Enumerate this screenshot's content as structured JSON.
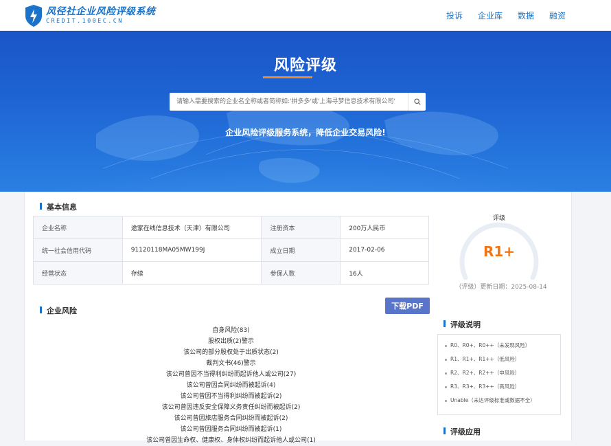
{
  "header": {
    "logo_main": "风径社企业风险评级系统",
    "logo_sub": "CREDIT.100EC.CN",
    "nav": [
      "投诉",
      "企业库",
      "数据",
      "融资"
    ]
  },
  "hero": {
    "title": "风险评级",
    "search_placeholder": "请输入需要搜索的企业名全称或者简称如:'拼多多'或'上海寻梦信息技术有限公司'",
    "slogan": "企业风险评级服务系统，降低企业交易风险!"
  },
  "basic_info": {
    "title": "基本信息",
    "rows": [
      [
        "企业名称",
        "途家在线信息技术（天津）有限公司",
        "注册资本",
        "200万人民币"
      ],
      [
        "统一社会信用代码",
        "91120118MA05MW199J",
        "成立日期",
        "2017-02-06"
      ],
      [
        "经营状态",
        "存续",
        "参保人数",
        "16人"
      ]
    ]
  },
  "rating": {
    "label": "评级",
    "value": "R1+",
    "date_text": "（评级）更新日期：2025-08-14"
  },
  "enterprise_risk": {
    "title": "企业风险",
    "pdf_button": "下载PDF",
    "items": [
      "自身风险(83)",
      "股权出质(2)警示",
      "该公司的部分股权处于出质状态(2)",
      "裁判文书(46)警示",
      "该公司曾因不当得利纠纷而起诉他人或公司(27)",
      "该公司曾因合同纠纷而被起诉(4)",
      "该公司曾因不当得利纠纷而被起诉(2)",
      "该公司曾因违反安全保障义务责任纠纷而被起诉(2)",
      "该公司曾因旅店服务合同纠纷而被起诉(2)",
      "该公司曾因服务合同纠纷而被起诉(1)",
      "该公司曾因生命权、健康权、身体权纠纷而起诉他人或公司(1)"
    ]
  },
  "rating_desc": {
    "title": "评级说明",
    "items": [
      "R0、R0+、R0++（未发现风险）",
      "R1、R1+、R1++（低风险）",
      "R2、R2+、R2++（中风险）",
      "R3、R3+、R3++（高风险）",
      "Unable（未达评级标准或数据不全）"
    ]
  },
  "rating_app": {
    "title": "评级应用"
  },
  "colors": {
    "brand": "#1a73c8",
    "accent": "#f08a24",
    "rating": "#f07514",
    "pdf_button": "#5875c9"
  }
}
